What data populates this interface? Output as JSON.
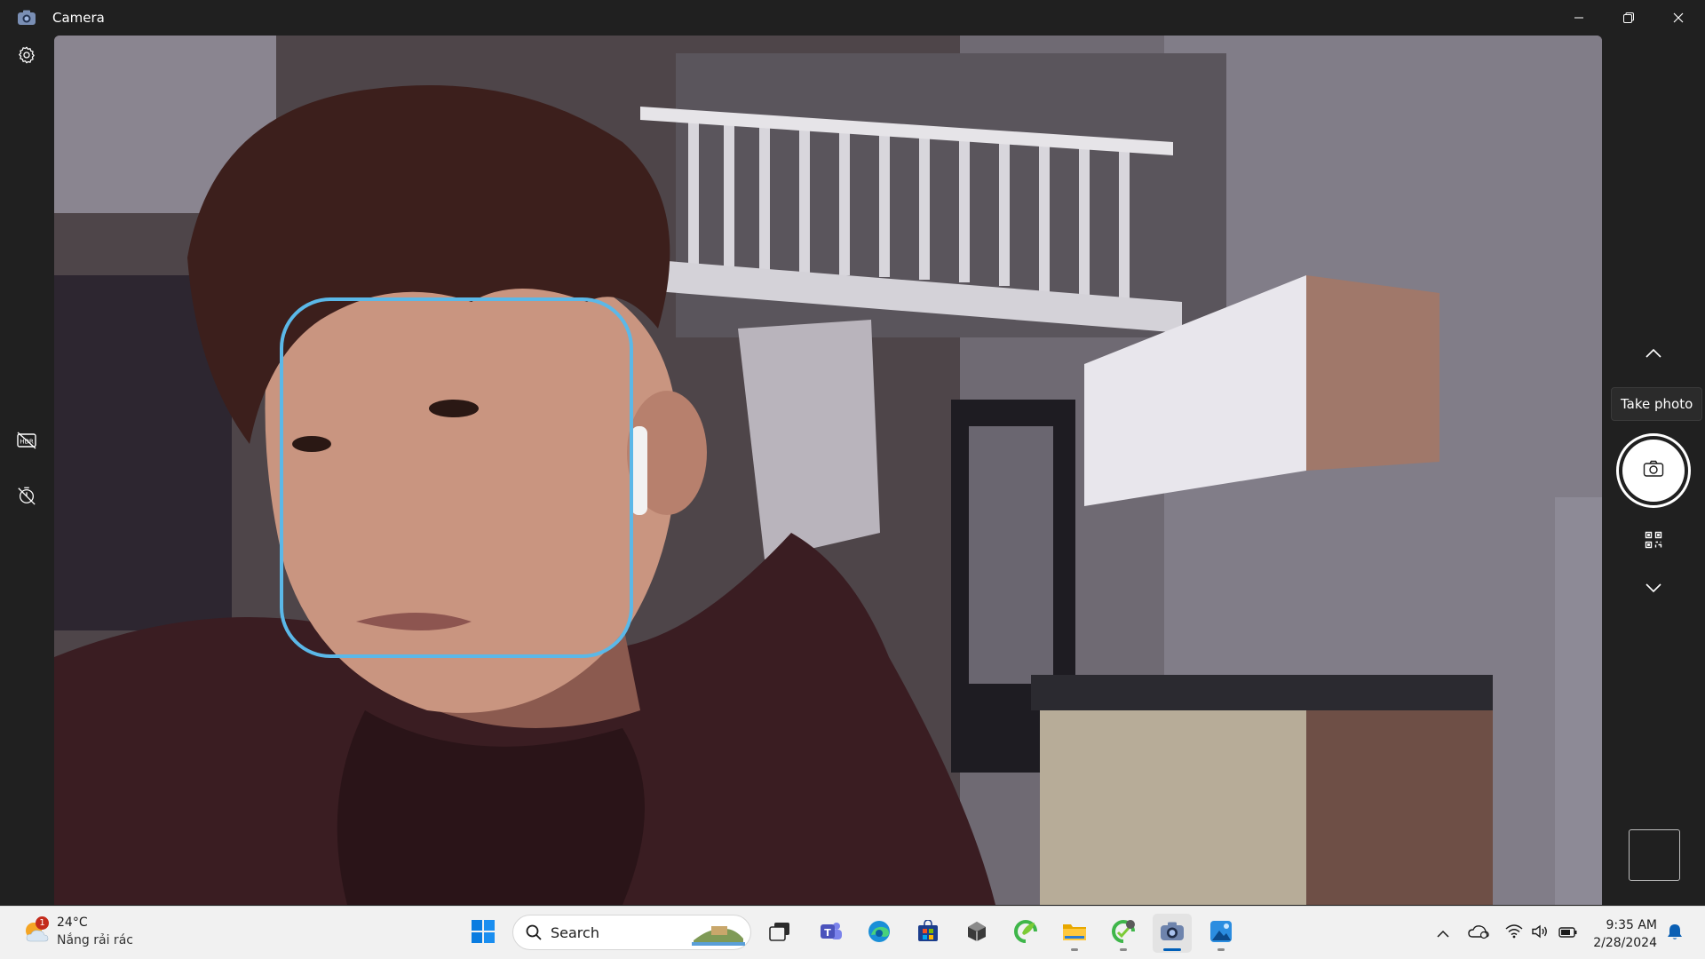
{
  "window": {
    "title": "Camera",
    "icons": {
      "app": "camera-app-icon",
      "minimize": "minimize-icon",
      "restore": "restore-icon",
      "close": "close-icon"
    }
  },
  "left_rail": {
    "items": [
      {
        "name": "settings-button",
        "icon": "gear-icon"
      },
      {
        "name": "hdr-toggle-button",
        "icon": "hdr-off-icon"
      },
      {
        "name": "timer-button",
        "icon": "timer-off-icon"
      }
    ]
  },
  "preview": {
    "face_box_color": "#5bb8e8"
  },
  "right_rail": {
    "tooltip": "Take photo",
    "items": [
      {
        "name": "mode-up-button",
        "icon": "chevron-up-icon"
      },
      {
        "name": "take-photo-button",
        "icon": "camera-icon"
      },
      {
        "name": "barcode-mode-button",
        "icon": "qr-code-icon"
      },
      {
        "name": "mode-down-button",
        "icon": "chevron-down-icon"
      },
      {
        "name": "last-capture-thumbnail",
        "icon": "thumbnail"
      }
    ]
  },
  "taskbar": {
    "weather": {
      "temp": "24°C",
      "desc": "Nắng rải rác",
      "badge": "1",
      "icon": "partly-sunny-icon"
    },
    "search": {
      "label": "Search",
      "icon": "search-icon"
    },
    "apps": [
      {
        "name": "start-button",
        "icon": "windows-logo-icon"
      },
      {
        "name": "task-view-button",
        "icon": "task-view-icon"
      },
      {
        "name": "teams-app",
        "icon": "teams-icon"
      },
      {
        "name": "edge-app",
        "icon": "edge-icon"
      },
      {
        "name": "store-app",
        "icon": "microsoft-store-icon"
      },
      {
        "name": "unity-app",
        "icon": "unity-icon"
      },
      {
        "name": "app-green-leaf",
        "icon": "leaf-app-icon"
      },
      {
        "name": "file-explorer-app",
        "icon": "folder-icon"
      },
      {
        "name": "app-green-circle",
        "icon": "green-circle-app-icon"
      },
      {
        "name": "camera-app",
        "icon": "camera-icon"
      },
      {
        "name": "photos-app",
        "icon": "photos-icon"
      }
    ],
    "tray": {
      "icons": [
        "chevron-up-icon",
        "onedrive-icon",
        "wifi-icon",
        "volume-icon",
        "battery-icon",
        "bell-icon"
      ],
      "time": "9:35 AM",
      "date": "2/28/2024"
    }
  }
}
